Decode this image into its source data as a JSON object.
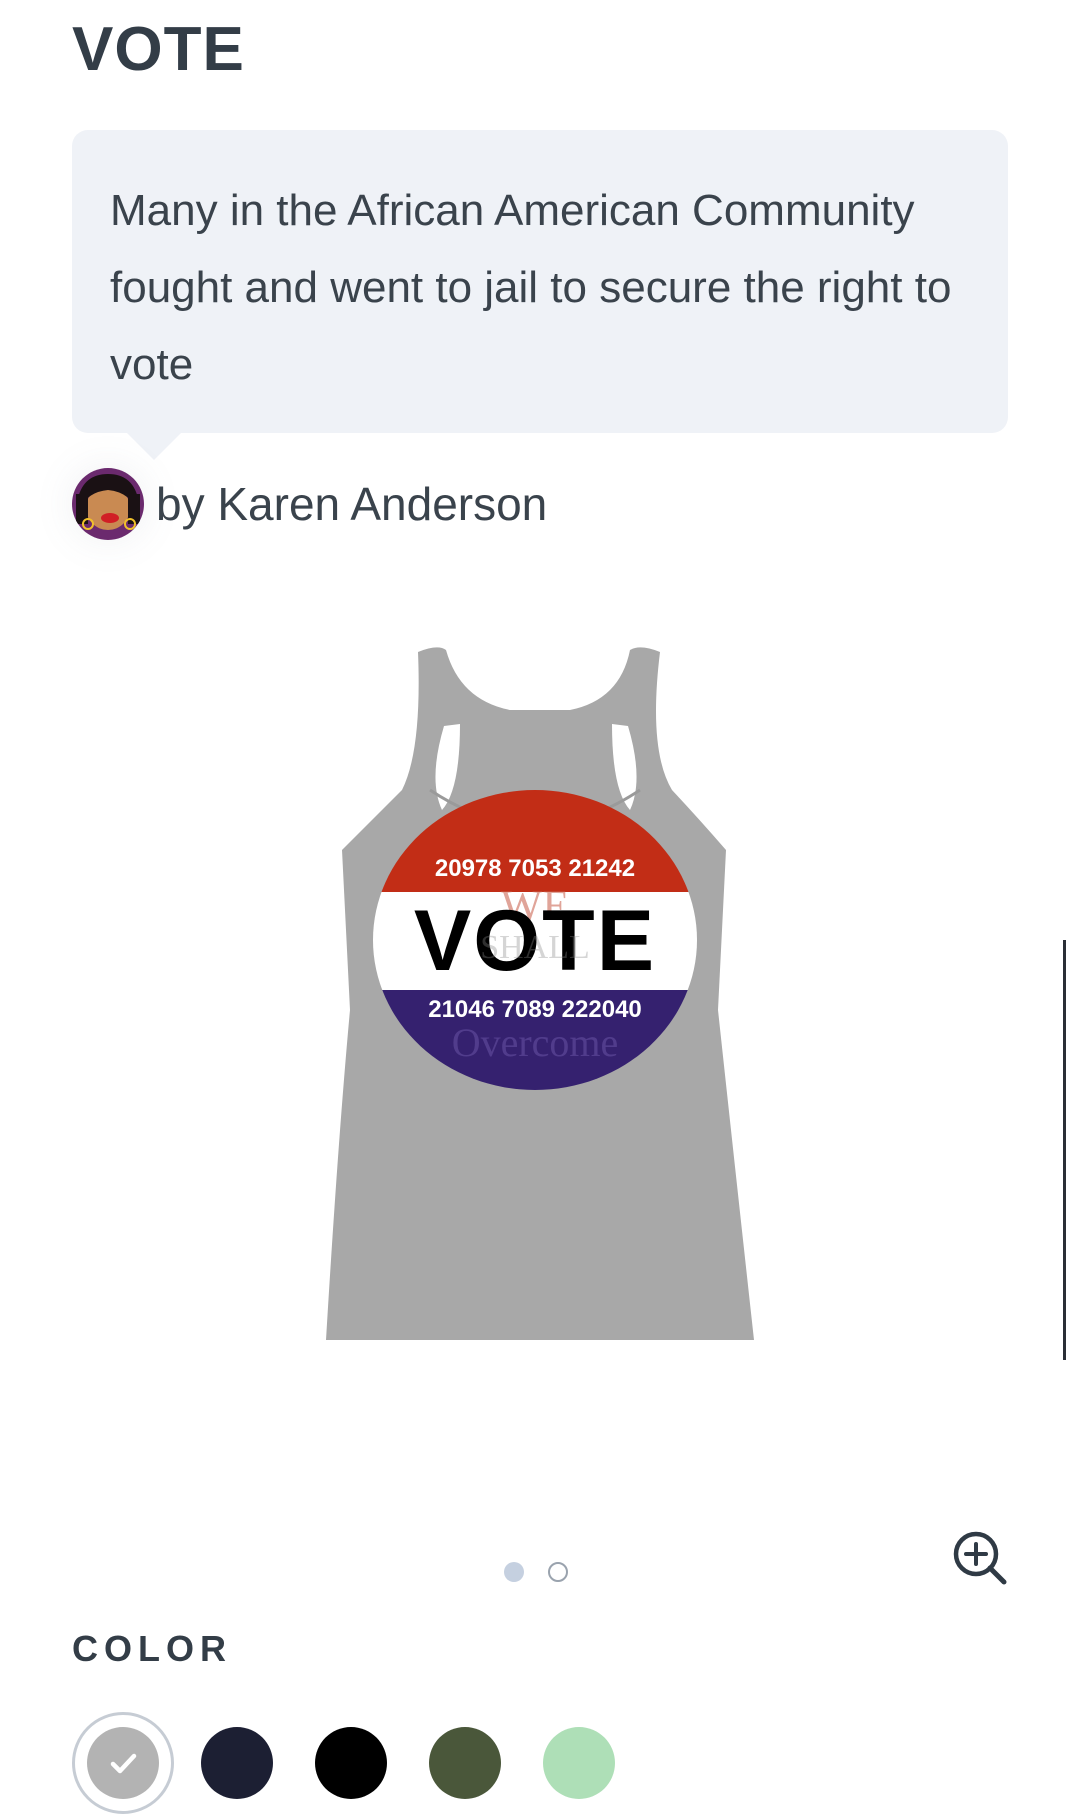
{
  "product": {
    "title": "VOTE",
    "description": "Many in the African American Community fought and went to jail to secure the right to vote",
    "author": "by Karen Anderson"
  },
  "design": {
    "top_numbers": "20978 7053 21242",
    "main_word": "VOTE",
    "bottom_numbers": "21046 7089 222040",
    "watermark_top": "WE",
    "watermark_middle": "SHALL",
    "watermark_bottom": "Overcome"
  },
  "gallery": {
    "total_images": 2,
    "active_index": 0,
    "zoom_icon": "zoom-in-icon"
  },
  "color_section": {
    "label": "COLOR",
    "swatches": [
      {
        "name": "heather-gray",
        "hex": "#b3b3b3",
        "selected": true
      },
      {
        "name": "navy",
        "hex": "#1c1f33",
        "selected": false
      },
      {
        "name": "black",
        "hex": "#000000",
        "selected": false
      },
      {
        "name": "olive",
        "hex": "#4a573a",
        "selected": false
      },
      {
        "name": "mint",
        "hex": "#aedfb7",
        "selected": false
      }
    ]
  }
}
